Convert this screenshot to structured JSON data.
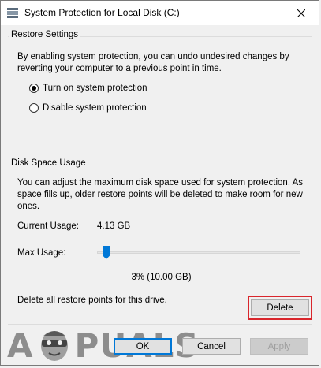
{
  "window": {
    "title": "System Protection for Local Disk (C:)",
    "accent": "#0078d7"
  },
  "restore_settings": {
    "label": "Restore Settings",
    "description_line1": "By enabling system protection, you can undo undesired changes by",
    "description_line2": "reverting your computer to a previous point in time.",
    "option_on": "Turn on system protection",
    "option_off": "Disable system protection",
    "selected": "option_on"
  },
  "disk_space": {
    "label": "Disk Space Usage",
    "description_line1": "You can adjust the maximum disk space used for system protection. As",
    "description_line2": "space fills up, older restore points will be deleted to make room for new",
    "description_line3": "ones.",
    "current_usage_label": "Current Usage:",
    "current_usage_value": "4.13 GB",
    "max_usage_label": "Max Usage:",
    "max_usage_percent": 3,
    "max_usage_readout": "3% (10.00 GB)",
    "delete_text": "Delete all restore points for this drive.",
    "delete_label": "Delete",
    "highlight_color": "#d9262c"
  },
  "footer": {
    "ok_label": "OK",
    "cancel_label": "Cancel",
    "apply_label": "Apply",
    "watermark_left": "A",
    "watermark_right": "PUALS"
  }
}
